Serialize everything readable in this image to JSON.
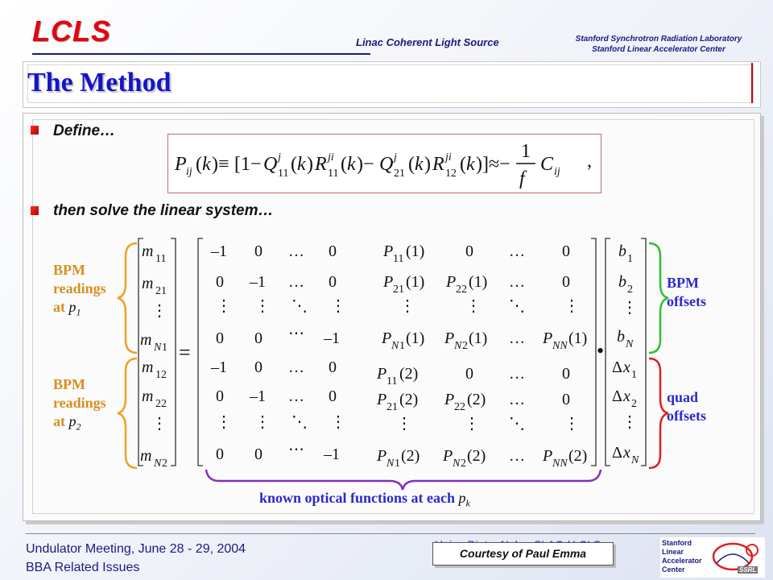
{
  "header": {
    "logo": "LCLS",
    "center": "Linac Coherent Light Source",
    "right_line1": "Stanford Synchrotron Radiation Laboratory",
    "right_line2": "Stanford Linear Accelerator Center"
  },
  "slide": {
    "title": "The Method",
    "bullets": [
      "Define…",
      "then solve the linear system…"
    ]
  },
  "labels": {
    "bpm_readings_1": [
      "BPM",
      "readings",
      "at"
    ],
    "p1": "p1",
    "bpm_readings_2": [
      "BPM",
      "readings",
      "at"
    ],
    "p2": "p2",
    "bpm_offsets": [
      "BPM",
      "offsets"
    ],
    "quad_offsets": [
      "quad",
      "offsets"
    ],
    "known": "known optical functions at each",
    "pk": "pk"
  },
  "footer": {
    "line1": "Undulator Meeting, June 28 - 29, 2004",
    "line2": "BBA Related Issues",
    "ghost": "Heinz-Dieter Nuhn, SLAC / LCLS",
    "courtesy": "Courtesy of Paul Emma",
    "logo_text": [
      "Stanford",
      "Linear",
      "Accelerator",
      "Center"
    ],
    "ssrl": "SSRL"
  },
  "colors": {
    "title": "#1515c8",
    "accent_red": "#e8000b",
    "label_orange": "#d59020",
    "label_blue": "#2a2ac8",
    "brace_orange": "#f0a020",
    "brace_green": "#30c030",
    "brace_red": "#e02020",
    "brace_purple": "#8030c0"
  }
}
